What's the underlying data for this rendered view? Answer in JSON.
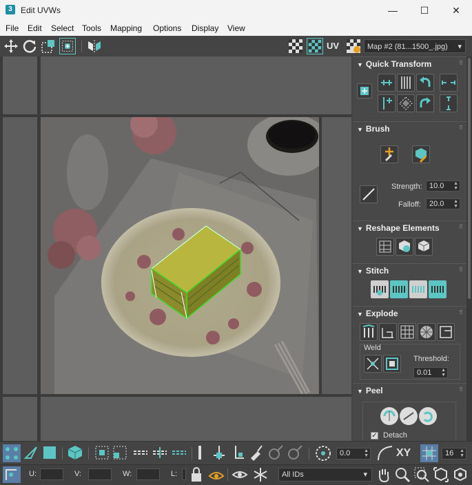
{
  "window": {
    "title": "Edit UVWs",
    "app_icon": "3",
    "minimize": "—",
    "maximize": "☐",
    "close": "✕"
  },
  "menu": [
    "File",
    "Edit",
    "Select",
    "Tools",
    "Mapping",
    "Options",
    "Display",
    "View"
  ],
  "toolbar": {
    "uv_label": "UV",
    "map_select": "Map #2 (81...1500_.jpg)"
  },
  "panel": {
    "quick_transform": {
      "title": "Quick Transform"
    },
    "brush": {
      "title": "Brush",
      "strength_label": "Strength:",
      "strength_value": "10.0",
      "falloff_label": "Falloff:",
      "falloff_value": "20.0"
    },
    "reshape": {
      "title": "Reshape Elements"
    },
    "stitch": {
      "title": "Stitch"
    },
    "explode": {
      "title": "Explode",
      "weld_label": "Weld",
      "threshold_label": "Threshold:",
      "threshold_value": "0.01"
    },
    "peel": {
      "title": "Peel",
      "detach_label": "Detach",
      "detach_checked": true
    }
  },
  "bottom_toolbar": {
    "spin_value": "0.0",
    "xy_label": "XY",
    "grid_value": "16"
  },
  "status_bar": {
    "u_label": "U:",
    "v_label": "V:",
    "w_label": "W:",
    "l_label": "L:",
    "ids_select": "All IDs"
  },
  "colors": {
    "accent": "#5cc6c4",
    "selection": "#3bdc2a"
  }
}
